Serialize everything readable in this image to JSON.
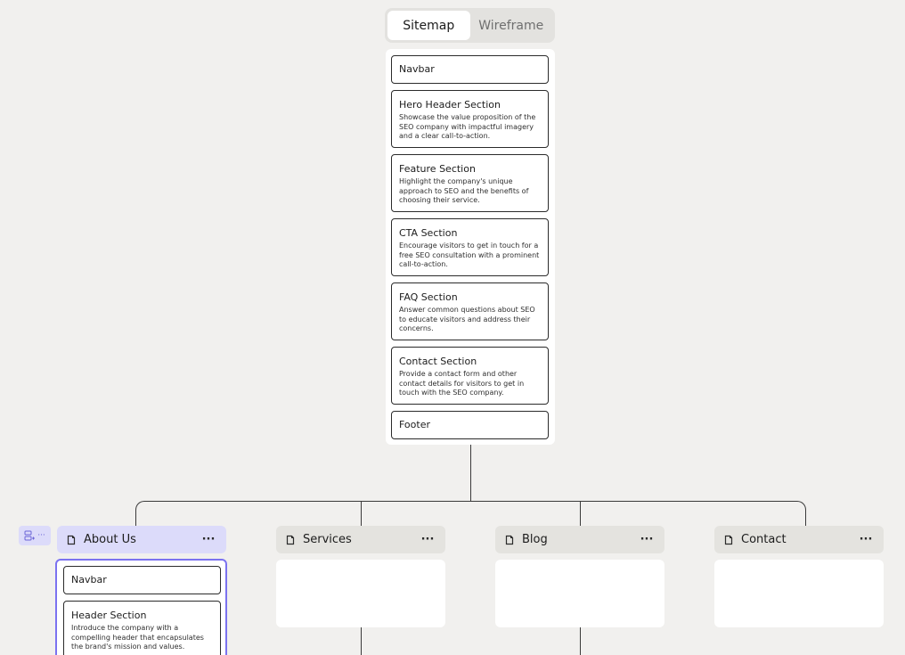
{
  "toggle": {
    "sitemap_label": "Sitemap",
    "wireframe_label": "Wireframe",
    "active": "Sitemap"
  },
  "home": {
    "sections": [
      {
        "title": "Navbar",
        "desc": ""
      },
      {
        "title": "Hero Header Section",
        "desc": "Showcase the value proposition of the SEO company with impactful imagery and a clear call-to-action."
      },
      {
        "title": "Feature Section",
        "desc": "Highlight the company's unique approach to SEO and the benefits of choosing their service."
      },
      {
        "title": "CTA Section",
        "desc": "Encourage visitors to get in touch for a free SEO consultation with a prominent call-to-action."
      },
      {
        "title": "FAQ Section",
        "desc": "Answer common questions about SEO to educate visitors and address their concerns."
      },
      {
        "title": "Contact Section",
        "desc": "Provide a contact form and other contact details for visitors to get in touch with the SEO company."
      },
      {
        "title": "Footer",
        "desc": ""
      }
    ]
  },
  "pages": [
    {
      "name": "About Us",
      "selected": true
    },
    {
      "name": "Services",
      "selected": false
    },
    {
      "name": "Blog",
      "selected": false
    },
    {
      "name": "Contact",
      "selected": false
    }
  ],
  "more_label": "···",
  "side_tool_label": "···",
  "about_sections": [
    {
      "title": "Navbar",
      "desc": ""
    },
    {
      "title": "Header Section",
      "desc": "Introduce the company with a compelling header that encapsulates the brand's mission and values."
    }
  ],
  "colors": {
    "background": "#f1f0ee",
    "selected_accent": "#7b72f0",
    "selected_fill": "#dcdbfa"
  }
}
